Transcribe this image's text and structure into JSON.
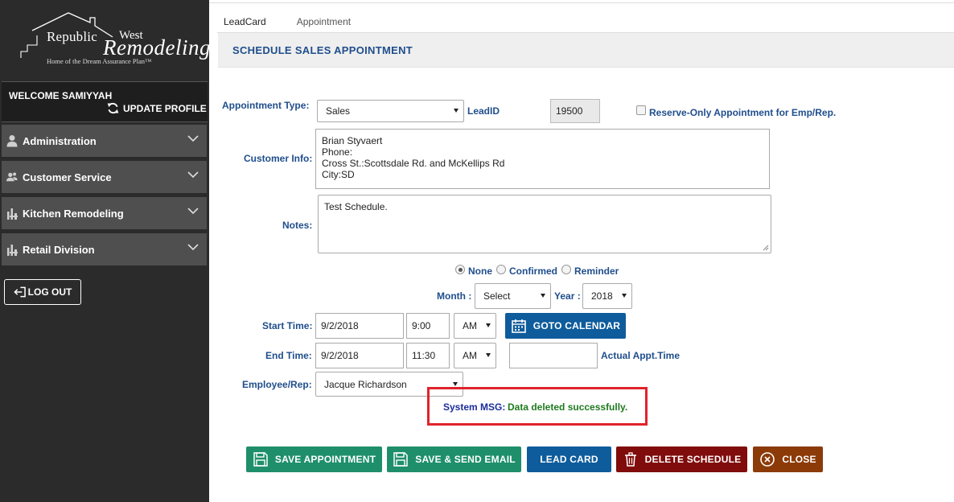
{
  "brand": {
    "name_part1": "Republic",
    "name_part2": "West",
    "name_part3": "Remodeling",
    "tagline": "Home of the Dream Assurance Plan™"
  },
  "sidebar": {
    "welcome": "WELCOME SAMIYYAH",
    "update_profile": "UPDATE PROFILE",
    "items": [
      {
        "label": "Administration",
        "icon": "user-icon"
      },
      {
        "label": "Customer Service",
        "icon": "users-icon"
      },
      {
        "label": "Kitchen Remodeling",
        "icon": "tools-icon"
      },
      {
        "label": "Retail Division",
        "icon": "tools-icon"
      }
    ],
    "logout": "LOG OUT"
  },
  "tabs": [
    "LeadCard",
    "Appointment"
  ],
  "header": {
    "title": "SCHEDULE SALES APPOINTMENT"
  },
  "form": {
    "appointment_type_label": "Appointment Type:",
    "appointment_type_value": "Sales",
    "leadid_label": "LeadID",
    "leadid_value": "19500",
    "reserve_only_label": "Reserve-Only Appointment for Emp/Rep.",
    "customer_info_label": "Customer Info:",
    "customer_info_lines": [
      "Brian Styvaert",
      "Phone:",
      "Cross St.:Scottsdale Rd. and McKellips Rd",
      "City:SD"
    ],
    "notes_label": "Notes:",
    "notes_value": "Test Schedule.",
    "status_options": [
      "None",
      "Confirmed",
      "Reminder"
    ],
    "status_selected": "None",
    "month_label": "Month :",
    "month_value": "Select",
    "year_label": "Year :",
    "year_value": "2018",
    "start_time_label": "Start Time:",
    "start_date": "9/2/2018",
    "start_time": "9:00",
    "start_ampm": "AM",
    "goto_calendar": "GOTO CALENDAR",
    "end_time_label": "End Time:",
    "end_date": "9/2/2018",
    "end_time": "11:30",
    "end_ampm": "AM",
    "actual_appt_time_label": "Actual Appt.Time",
    "actual_appt_time_value": "",
    "employee_label": "Employee/Rep:",
    "employee_value": "Jacque Richardson"
  },
  "system_msg": {
    "label": "System MSG:",
    "text": "Data deleted successfully."
  },
  "actions": {
    "save_appointment": "SAVE APPOINTMENT",
    "save_send_email": "SAVE & SEND EMAIL",
    "lead_card": "LEAD CARD",
    "delete_schedule": "DELETE SCHEDULE",
    "close": "CLOSE"
  },
  "colors": {
    "sidebar_bg": "#2b2b2b",
    "menu_bg": "#4f4f4f",
    "label_blue": "#1f4e8c",
    "btn_green": "#1e8f6a",
    "btn_blue": "#0e5c9c",
    "btn_darkred": "#800c0c",
    "btn_brown": "#8c3a07",
    "msg_border": "#e1232b"
  }
}
